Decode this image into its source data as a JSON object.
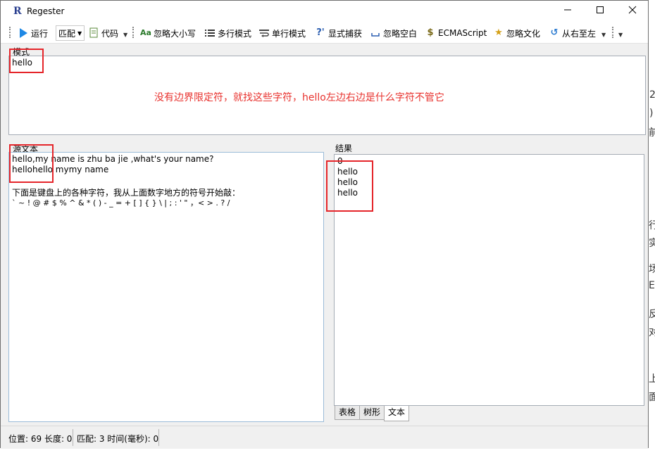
{
  "window": {
    "title": "Regester",
    "app_icon": "R",
    "controls": {
      "minimize": "—",
      "maximize": "☐",
      "close": "✕"
    }
  },
  "toolbar": {
    "run": "运行",
    "match": "匹配",
    "code": "代码",
    "ignore_case": "忽略大小写",
    "multiline": "多行模式",
    "singleline": "单行模式",
    "explicit_capture": "显式捕获",
    "ignore_whitespace": "忽略空白",
    "ecmascript": "ECMAScript",
    "ignore_culture": "忽略文化",
    "right_to_left": "从右至左"
  },
  "pattern": {
    "label": "模式",
    "value": "hello"
  },
  "annotation": "没有边界限定符，就找这些字符，hello左边右边是什么字符不管它",
  "source": {
    "label": "源文本",
    "lines": [
      "hello,my name is zhu ba jie ,what's your name?",
      "hellohello mymy name",
      "",
      "下面是键盘上的各种字符，我从上面数字地方的符号开始敲：",
      "` ~ ! @ # $ % ^ & * ( ) - _ = + [ ] { } \\ | ; : ' \" ，< > . ? /"
    ]
  },
  "result": {
    "label": "结果",
    "lines": [
      "0",
      "hello",
      "hello",
      "hello"
    ],
    "tabs": [
      "表格",
      "树形",
      "文本"
    ],
    "active_tab": "文本"
  },
  "status": {
    "position_length": "位置: 69 长度: 0",
    "match_time": "匹配: 3 时间(毫秒): 0"
  },
  "colors": {
    "annotation": "#e8322e",
    "red_box": "#e5252a",
    "run_icon": "#1e88e5"
  },
  "background_fragments": [
    "2",
    ")",
    "前",
    "行",
    "实",
    "场",
    "E",
    "反",
    "对",
    "上",
    "面"
  ]
}
